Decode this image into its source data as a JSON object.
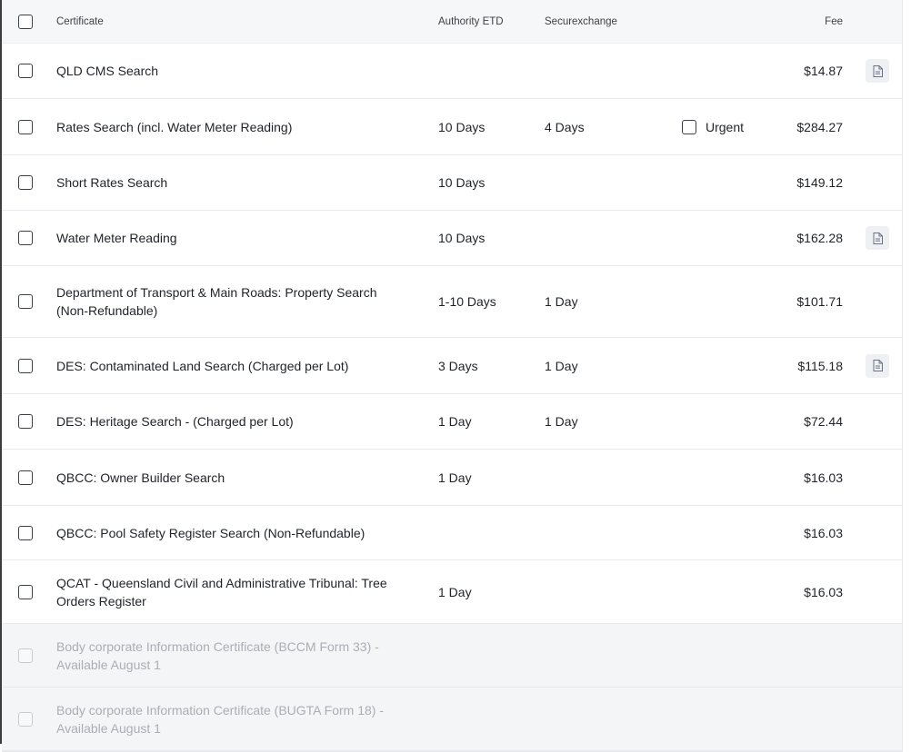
{
  "header": {
    "certificate": "Certificate",
    "authority_etd": "Authority ETD",
    "securexchange": "Securexchange",
    "fee": "Fee"
  },
  "rows": [
    {
      "name": "QLD CMS Search",
      "etd": "",
      "sec": "",
      "urgent": "",
      "fee": "$14.87",
      "doc": true,
      "disabled": false
    },
    {
      "name": "Rates Search (incl. Water Meter Reading)",
      "etd": "10 Days",
      "sec": "4 Days",
      "urgent": "Urgent",
      "fee": "$284.27",
      "doc": false,
      "disabled": false
    },
    {
      "name": "Short Rates Search",
      "etd": "10 Days",
      "sec": "",
      "urgent": "",
      "fee": "$149.12",
      "doc": false,
      "disabled": false
    },
    {
      "name": "Water Meter Reading",
      "etd": "10 Days",
      "sec": "",
      "urgent": "",
      "fee": "$162.28",
      "doc": true,
      "disabled": false
    },
    {
      "name": "Department of Transport & Main Roads: Property Search (Non-Refundable)",
      "etd": "1-10 Days",
      "sec": "1 Day",
      "urgent": "",
      "fee": "$101.71",
      "doc": false,
      "disabled": false
    },
    {
      "name": "DES: Contaminated Land Search (Charged per Lot)",
      "etd": "3 Days",
      "sec": "1 Day",
      "urgent": "",
      "fee": "$115.18",
      "doc": true,
      "disabled": false
    },
    {
      "name": "DES: Heritage Search - (Charged per Lot)",
      "etd": "1 Day",
      "sec": "1 Day",
      "urgent": "",
      "fee": "$72.44",
      "doc": false,
      "disabled": false
    },
    {
      "name": "QBCC: Owner Builder Search",
      "etd": "1 Day",
      "sec": "",
      "urgent": "",
      "fee": "$16.03",
      "doc": false,
      "disabled": false
    },
    {
      "name": "QBCC: Pool Safety Register Search (Non-Refundable)",
      "etd": "",
      "sec": "",
      "urgent": "",
      "fee": "$16.03",
      "doc": false,
      "disabled": false
    },
    {
      "name": "QCAT - Queensland Civil and Administrative Tribunal: Tree Orders Register",
      "etd": "1 Day",
      "sec": "",
      "urgent": "",
      "fee": "$16.03",
      "doc": false,
      "disabled": false
    },
    {
      "name": "Body corporate Information Certificate (BCCM Form 33) - Available August 1",
      "etd": "",
      "sec": "",
      "urgent": "",
      "fee": "",
      "doc": false,
      "disabled": true
    },
    {
      "name": "Body corporate Information Certificate (BUGTA Form 18) - Available August 1",
      "etd": "",
      "sec": "",
      "urgent": "",
      "fee": "",
      "doc": false,
      "disabled": true
    }
  ]
}
